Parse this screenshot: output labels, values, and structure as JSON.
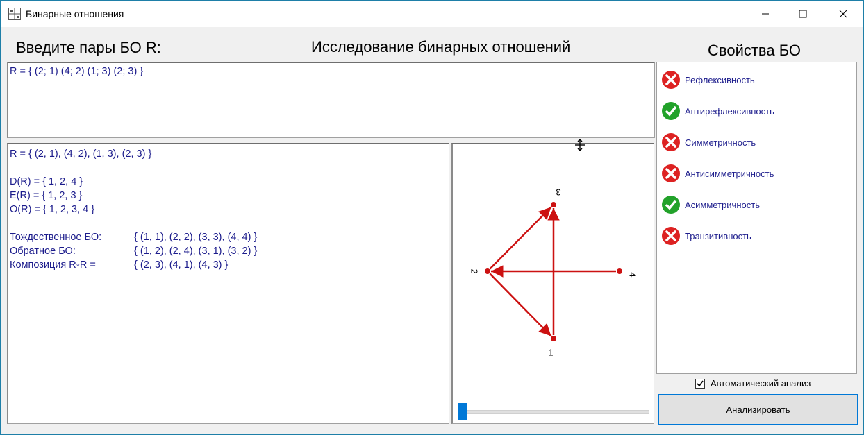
{
  "window": {
    "title": "Бинарные отношения"
  },
  "headers": {
    "input_title": "Введите пары БО R:",
    "main_title": "Исследование бинарных отношений",
    "props_title": "Свойства БО"
  },
  "input": {
    "text": "R = { (2; 1) (4; 2) (1; 3) (2; 3) }"
  },
  "output": {
    "relation": "R = { (2, 1), (4, 2), (1, 3), (2, 3) }",
    "domain": "D(R) = { 1, 2, 4 }",
    "range": "E(R) = { 1, 2, 3 }",
    "field": "O(R) = { 1, 2, 3, 4 }",
    "identity_label": "Тождественное БО:",
    "identity_value": "{ (1, 1), (2, 2), (3, 3), (4, 4) }",
    "inverse_label": "Обратное БО:",
    "inverse_value": "{ (1, 2), (2, 4), (3, 1), (3, 2) }",
    "composition_label": "Композиция R◦R =",
    "composition_value": "{ (2, 3), (4, 1), (4, 3) }"
  },
  "graph": {
    "nodes": [
      {
        "label": "1"
      },
      {
        "label": "2"
      },
      {
        "label": "3"
      },
      {
        "label": "4"
      }
    ],
    "edges": [
      [
        "2",
        "1"
      ],
      [
        "4",
        "2"
      ],
      [
        "1",
        "3"
      ],
      [
        "2",
        "3"
      ]
    ],
    "slider_value": 0
  },
  "properties": [
    {
      "label": "Рефлексивность",
      "status": "no"
    },
    {
      "label": "Антирефлексивность",
      "status": "yes"
    },
    {
      "label": "Симметричность",
      "status": "no"
    },
    {
      "label": "Антисимметричность",
      "status": "no"
    },
    {
      "label": "Асимметричность",
      "status": "yes"
    },
    {
      "label": "Транзитивность",
      "status": "no"
    }
  ],
  "auto_analysis": {
    "label": "Автоматический анализ",
    "checked": true
  },
  "analyze_button": {
    "label": "Анализировать"
  },
  "colors": {
    "accent": "#0078d7",
    "text_blue": "#1c1c8c",
    "edge_red": "#cc1111",
    "ok_green": "#22a22a",
    "fail_red": "#dd2222"
  }
}
